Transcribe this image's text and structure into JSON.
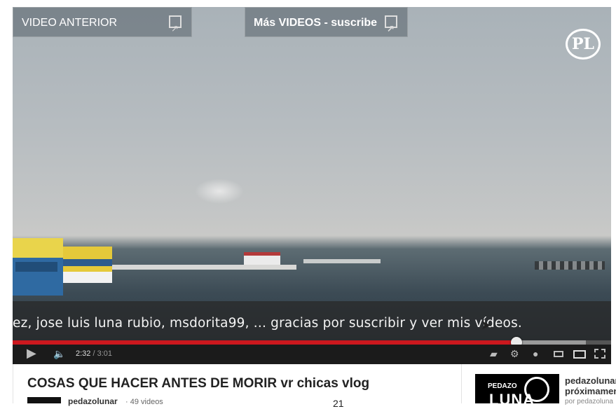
{
  "player": {
    "annotations": {
      "previous_label": "VIDEO ANTERIOR",
      "more_label": "Más VIDEOS - suscribe"
    },
    "logo_text": "PL",
    "caption": "ez, jose luis luna rubio, msdorita99, ... gracias por suscribir y ver mis vídeos.",
    "progress": {
      "current_time": "2:32",
      "separator": " / ",
      "duration": "3:01",
      "played_fraction": 0.842,
      "loaded_fraction": 0.958
    },
    "controls": {
      "play_icon": "play-icon",
      "volume_icon": "volume-icon",
      "right_icons": [
        "captions-icon",
        "settings-icon",
        "watch-later-icon",
        "small-player-icon",
        "large-player-icon",
        "fullscreen-icon"
      ]
    },
    "colors": {
      "progress_played": "#cc181e"
    }
  },
  "video_info": {
    "title": "COSAS QUE HACER ANTES DE MORIR vr chicas vlog",
    "channel_name": "pedazolunar",
    "video_count": "· 49 videos",
    "views_partial": "21"
  },
  "sidebar": {
    "thumb_text_1": "PEDAZO",
    "thumb_text_2": "LUNA",
    "title_line_1": "pedazolunar",
    "title_line_2": "próximamen",
    "by_line": "por pedazoluna"
  }
}
